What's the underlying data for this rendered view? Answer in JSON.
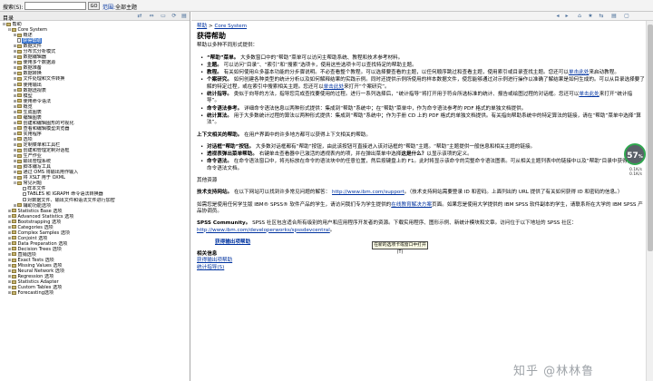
{
  "search": {
    "label": "搜索(S):",
    "value": "",
    "go": "GO",
    "scope_link": "范围:",
    "scope_value": "全部主题"
  },
  "toc": {
    "title": "目录",
    "items": [
      {
        "label": "帮助",
        "level": 0,
        "kind": "book",
        "toggle": "-"
      },
      {
        "label": "Core System",
        "level": 1,
        "kind": "book",
        "toggle": "-"
      },
      {
        "label": "概述",
        "level": 2,
        "kind": "book",
        "toggle": "+"
      },
      {
        "label": "获得帮助",
        "level": 2,
        "kind": "page",
        "toggle": "",
        "selected": true
      },
      {
        "label": "数据文件",
        "level": 2,
        "kind": "book",
        "toggle": "+"
      },
      {
        "label": "分布式分析模式",
        "level": 2,
        "kind": "book",
        "toggle": "+"
      },
      {
        "label": "数据编辑器",
        "level": 2,
        "kind": "book",
        "toggle": "+"
      },
      {
        "label": "使用多个数据源",
        "level": 2,
        "kind": "book",
        "toggle": "+"
      },
      {
        "label": "数据准备",
        "level": 2,
        "kind": "book",
        "toggle": "+"
      },
      {
        "label": "数据转换",
        "level": 2,
        "kind": "book",
        "toggle": "+"
      },
      {
        "label": "文件处理和文件转换",
        "level": 2,
        "kind": "book",
        "toggle": "+"
      },
      {
        "label": "使用输出",
        "level": 2,
        "kind": "book",
        "toggle": "+"
      },
      {
        "label": "数据透视表",
        "level": 2,
        "kind": "book",
        "toggle": "+"
      },
      {
        "label": "模型",
        "level": 2,
        "kind": "book",
        "toggle": "+"
      },
      {
        "label": "使用命令语法",
        "level": 2,
        "kind": "book",
        "toggle": "+"
      },
      {
        "label": "概览",
        "level": 2,
        "kind": "book",
        "toggle": "+"
      },
      {
        "label": "生成图表",
        "level": 2,
        "kind": "book",
        "toggle": "+"
      },
      {
        "label": "编辑图表",
        "level": 2,
        "kind": "book",
        "toggle": "+"
      },
      {
        "label": "创建和编辑图形的可视化",
        "level": 2,
        "kind": "book",
        "toggle": "+"
      },
      {
        "label": "查看和编辑模型浏览器",
        "level": 2,
        "kind": "book",
        "toggle": "+"
      },
      {
        "label": "实用程序",
        "level": 2,
        "kind": "book",
        "toggle": "+"
      },
      {
        "label": "选项",
        "level": 2,
        "kind": "book",
        "toggle": "+"
      },
      {
        "label": "定制菜单和工具栏",
        "level": 2,
        "kind": "book",
        "toggle": "+"
      },
      {
        "label": "创建和管理定制对话框",
        "level": 2,
        "kind": "book",
        "toggle": "+"
      },
      {
        "label": "生产作业",
        "level": 2,
        "kind": "book",
        "toggle": "+"
      },
      {
        "label": "输出管理系统",
        "level": 2,
        "kind": "book",
        "toggle": "+"
      },
      {
        "label": "脚本编写工具",
        "level": 2,
        "kind": "book",
        "toggle": "+"
      },
      {
        "label": "通过 OMS 将输出用作输入",
        "level": 2,
        "kind": "book",
        "toggle": "+"
      },
      {
        "label": "将 XSLT 用于 OXML",
        "level": 2,
        "kind": "book",
        "toggle": "+"
      },
      {
        "label": "常见问题",
        "level": 2,
        "kind": "book",
        "toggle": "-"
      },
      {
        "label": "样本文件",
        "level": 3,
        "kind": "page",
        "toggle": ""
      },
      {
        "label": "TABLES 和 IGRAPH 命令语法转换器",
        "level": 3,
        "kind": "page",
        "toggle": ""
      },
      {
        "label": "对数据文件、输出文件和语法文件进行加密",
        "level": 3,
        "kind": "page",
        "toggle": ""
      },
      {
        "label": "辅助功能选项",
        "level": 2,
        "kind": "book",
        "toggle": "+"
      },
      {
        "label": "Statistics Base 选项",
        "level": 1,
        "kind": "book",
        "toggle": "+"
      },
      {
        "label": "Advanced Statistics 选项",
        "level": 1,
        "kind": "book",
        "toggle": "+"
      },
      {
        "label": "Bootstrapping 选项",
        "level": 1,
        "kind": "book",
        "toggle": "+"
      },
      {
        "label": "Categories 选项",
        "level": 1,
        "kind": "book",
        "toggle": "+"
      },
      {
        "label": "Complex Samples 选项",
        "level": 1,
        "kind": "book",
        "toggle": "+"
      },
      {
        "label": "Conjoint 选项",
        "level": 1,
        "kind": "book",
        "toggle": "+"
      },
      {
        "label": "Data Preparation 选项",
        "level": 1,
        "kind": "book",
        "toggle": "+"
      },
      {
        "label": "Decision Trees 选项",
        "level": 1,
        "kind": "book",
        "toggle": "+"
      },
      {
        "label": "直销选项",
        "level": 1,
        "kind": "book",
        "toggle": "+"
      },
      {
        "label": "Exact Tests 选项",
        "level": 1,
        "kind": "book",
        "toggle": "+"
      },
      {
        "label": "Missing Values 选项",
        "level": 1,
        "kind": "book",
        "toggle": "+"
      },
      {
        "label": "Neural Network 选项",
        "level": 1,
        "kind": "book",
        "toggle": "+"
      },
      {
        "label": "Regression 选项",
        "level": 1,
        "kind": "book",
        "toggle": "+"
      },
      {
        "label": "Statistics Adapter",
        "level": 1,
        "kind": "book",
        "toggle": "+"
      },
      {
        "label": "Custom Tables 选项",
        "level": 1,
        "kind": "book",
        "toggle": "+"
      },
      {
        "label": "Forecasting选项",
        "level": 1,
        "kind": "book",
        "toggle": "+"
      }
    ]
  },
  "article": {
    "breadcrumb": [
      "帮助",
      "Core System"
    ],
    "title": "获得帮助",
    "intro": "帮助以多种不同形式提供：",
    "bullets1": [
      {
        "lead": "“帮助”菜单。",
        "text": "大多数窗口中的“帮助”菜单可以访问主帮助系统、教程和技术参考材料。"
      },
      {
        "lead": "主题。",
        "text": "可以访问“目录”、“索引”和“搜索”选项卡，使用这些选项卡可以查找特定的帮助主题。"
      },
      {
        "lead": "教程。",
        "text": "有关如何使用众多基本功能的分步骤说明。不必查看整个教程。可以选择要查看的主题，以任何顺序跳过和查看主题，使用索引或目录查找主题。您还可以",
        "link": "单击此处",
        "after": "来启动教程。"
      },
      {
        "lead": "个案研究。",
        "text": "如何创建各种类型的统计分析以及如何解释结果的实践示例。同时还提供示例所使用的样本数据文件，使您能够通过对示例进行操作以准确了解结果是如何生成的。可以从目录选择要了解的特定过程，或在索引中搜索相关主题。您还可以",
        "link": "单击此处",
        "after": "来打开“个案研究”。"
      },
      {
        "lead": "统计指导。",
        "text": "类似于向导的方法，指导您完成查找要使用的过程。进行一系列选择后，“统计指导”将打开用于符合所选标准的统计、报告或绘图过程的对话框。您还可以",
        "link": "单击此处",
        "after": "来打开“统计指导”。"
      },
      {
        "lead": "命令语法参考。",
        "text": "详细命令语法信息以两种形式提供：集成到“帮助”系统中；在“帮助”菜单中，作为命令语法参考的 PDF 格式的单独文档提供。"
      },
      {
        "lead": "统计算法。",
        "text": "用于大多数统计过程的算法以两种形式提供：集成到“帮助”系统中；作为手册 CD 上的 PDF 格式的单独文档提供。有关指向帮助系统中的特定算法的链接，请在“帮助”菜单中选择“算法”。"
      }
    ],
    "context_lead": "上下文相关的帮助。",
    "context_text": "在用户界面中的许多地方都可以获得上下文相关的帮助。",
    "bullets2": [
      {
        "lead": "对话框“帮助”按钮。",
        "text": "大多数对话框都有“帮助”按钮，由此该按钮可直接进入该对话框的“帮助”主题。“帮助”主题提供一般信息和相关主题的链接。"
      },
      {
        "lead": "透视表弹出菜单帮助。",
        "text": "右键单击查看器中已激活的透视表内的项，并在弹出菜单中选择",
        "bold2": "这是什么？",
        "after": "以显示该项的定义。"
      },
      {
        "lead": "命令语法。",
        "text": "在命令语法窗口中，将光标放在命令的语法块中的任意位置，然后按键盘上的 F1。此时将显示该命令的完整命令语法图表。可从相关主题列表中的链接中以及“帮助”目录中获得完整的命令语法文档。"
      }
    ],
    "other_head": "其他资源",
    "tech_lead": "技术支持网站。",
    "tech_text": "在以下网站可以找到许多常见问题的解答：",
    "tech_url": "http://www.ibm.com/support",
    "tech_after": "。（技术支持网站需要登录 ID 和密码。上面列出的 URL 提供了有关如何获得 ID 和密码的信息。）",
    "train_text": "如需您是使用任何学生版 IBM® SPSS® 软件产品的学生，请访问我们专为学生提供的",
    "train_link": "在线教育解决方案",
    "train_after": "页面。如果您是使用大学提供的 IBM SPSS 软件副本的学生，请联系所在大学的 IBM SPSS 产品协调员。",
    "comm_lead": "SPSS Community。",
    "comm_text": "SPSS 社区包含适合所有级别的用户和应用程序开发者的资源。下载实用程序、图形示例、新统计模块和文章。访问位于以下地址的 SPSS 社区：",
    "comm_url": "http://www.ibm.com/developerworks/spssdevcentral",
    "comm_after": "。",
    "pdf_link": "获得输出项帮助",
    "related_head": "相关信息",
    "related": [
      "获得输出项帮助",
      "统计指导(S)"
    ]
  },
  "tooltip": "在新的选项卡或窗口中打开(T)",
  "badge": {
    "value": "57",
    "unit": "%"
  },
  "rates": [
    "0.1K/s",
    "0.1K/s"
  ],
  "watermark": "知乎 @林林鲁"
}
